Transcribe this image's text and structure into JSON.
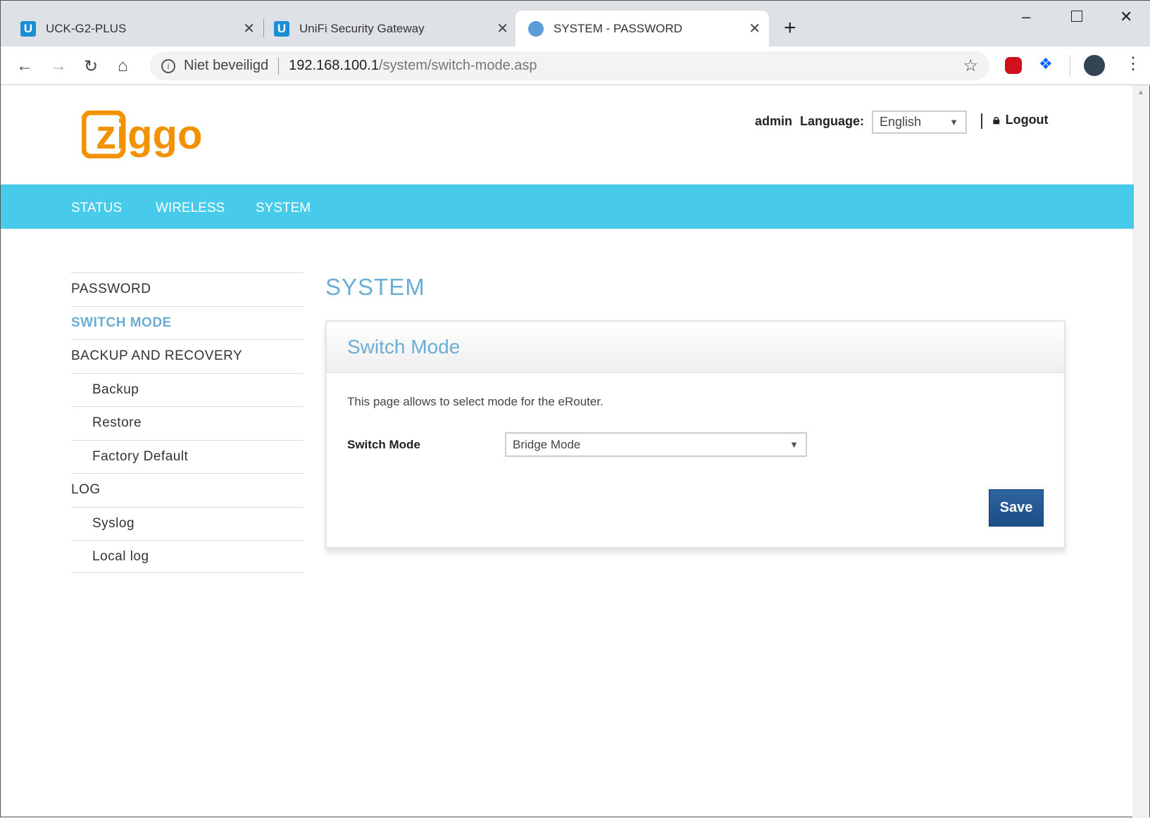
{
  "browser": {
    "tabs": [
      {
        "title": "UCK-G2-PLUS",
        "icon": "ubiquiti-icon"
      },
      {
        "title": "UniFi Security Gateway",
        "icon": "ubiquiti-icon"
      },
      {
        "title": "SYSTEM - PASSWORD",
        "icon": "globe-icon",
        "active": true
      }
    ],
    "security_label": "Niet beveiligd",
    "url_host": "192.168.100.1",
    "url_path": "/system/switch-mode.asp"
  },
  "header": {
    "logo_text": "ziggo",
    "user": "admin",
    "language_label": "Language:",
    "language_value": "English",
    "logout": "Logout"
  },
  "nav": [
    "STATUS",
    "WIRELESS",
    "SYSTEM"
  ],
  "sidebar": [
    "PASSWORD",
    "SWITCH MODE",
    "BACKUP AND RECOVERY",
    "Backup",
    "Restore",
    "Factory Default",
    "LOG",
    "Syslog",
    "Local log"
  ],
  "main": {
    "heading": "SYSTEM",
    "panel_title": "Switch Mode",
    "description": "This page allows to select mode for the eRouter.",
    "field_label": "Switch Mode",
    "field_value": "Bridge Mode",
    "save": "Save"
  },
  "colors": {
    "accent": "#48cbea",
    "heading": "#6aaed6",
    "logo": "#f39200",
    "button": "#1e4f8a"
  }
}
